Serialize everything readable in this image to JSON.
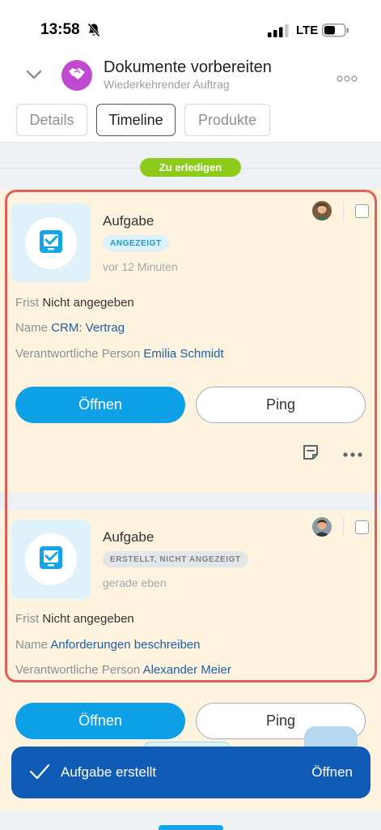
{
  "status_bar": {
    "time": "13:58",
    "network": "LTE"
  },
  "header": {
    "title": "Dokumente vorbereiten",
    "subtitle": "Wiederkehrender Auftrag"
  },
  "tabs": [
    {
      "label": "Details"
    },
    {
      "label": "Timeline",
      "active": true
    },
    {
      "label": "Produkte"
    }
  ],
  "timeline": {
    "status_pill": "Zu erledigen",
    "cards": [
      {
        "title": "Aufgabe",
        "badge": "ANGEZEIGT",
        "time": "vor 12 Minuten",
        "deadline_label": "Frist",
        "deadline_value": "Nicht angegeben",
        "name_label": "Name",
        "name_value": "CRM: Vertrag",
        "person_label": "Verantwortliche Person",
        "person_value": "Emilia Schmidt",
        "open_label": "Öffnen",
        "ping_label": "Ping"
      },
      {
        "title": "Aufgabe",
        "badge": "ERSTELLT, NICHT ANGEZEIGT",
        "time": "gerade eben",
        "deadline_label": "Frist",
        "deadline_value": "Nicht angegeben",
        "name_label": "Name",
        "name_value": "Anforderungen beschreiben",
        "person_label": "Verantwortliche Person",
        "person_value": "Alexander Meier",
        "open_label": "Öffnen",
        "ping_label": "Ping"
      }
    ]
  },
  "toast": {
    "message": "Aufgabe erstellt",
    "action": "Öffnen"
  },
  "colors": {
    "accent": "#0ea1e8",
    "link": "#1f5fa8",
    "status_pill": "#8ccb1a",
    "card_background": "#fdf3df",
    "toast_background": "#0f5bb5",
    "highlight": "#e1615a"
  }
}
